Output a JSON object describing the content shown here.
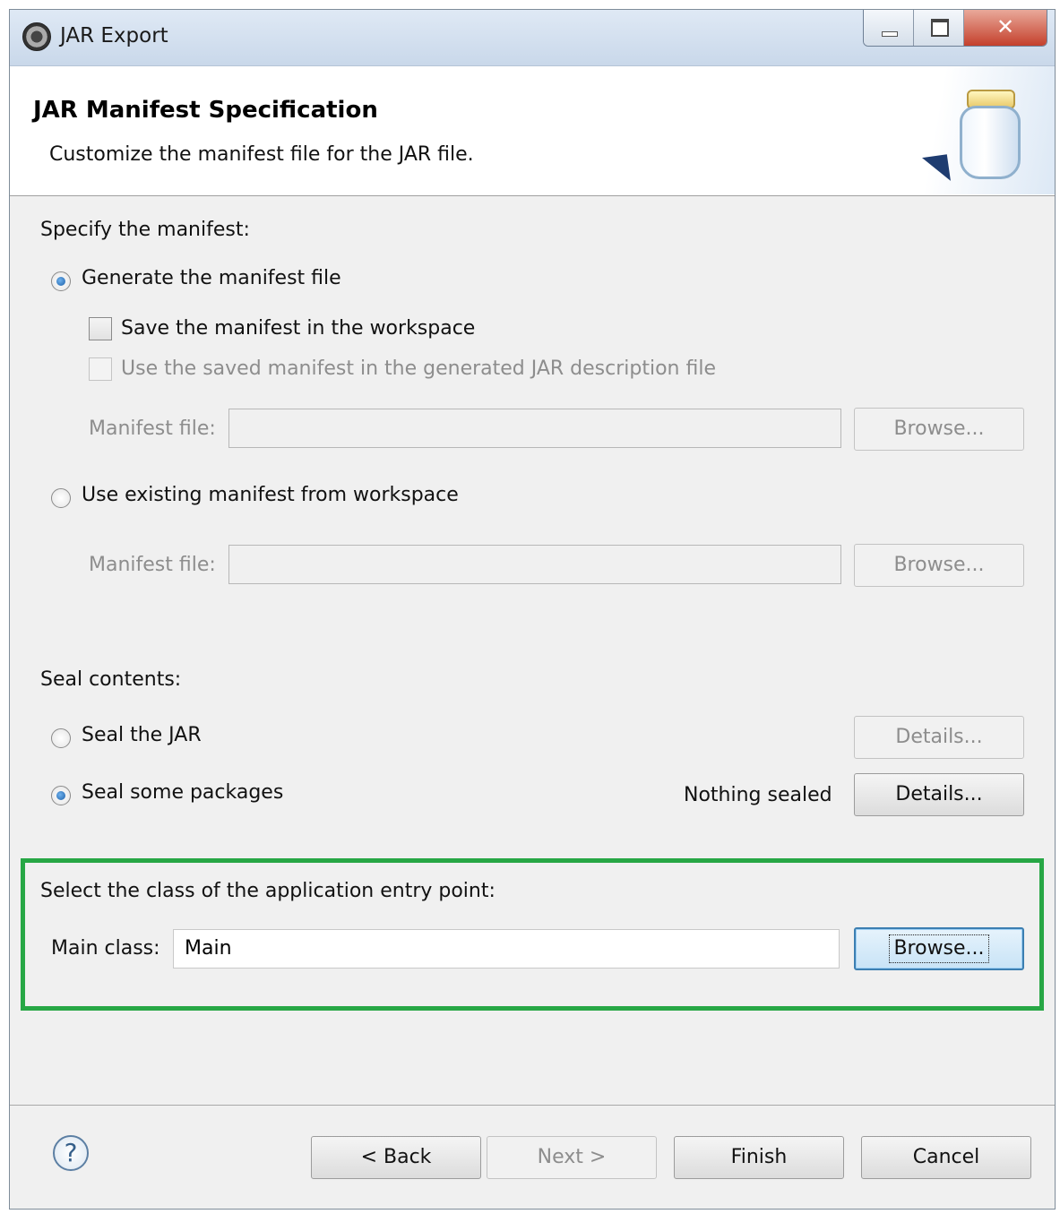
{
  "window": {
    "title": "JAR Export",
    "icon": "eclipse-icon"
  },
  "header": {
    "title": "JAR Manifest Specification",
    "description": "Customize the manifest file for the JAR file.",
    "graphic": "jar-icon"
  },
  "manifest": {
    "section_label": "Specify the manifest:",
    "generate_option": {
      "label": "Generate the manifest file",
      "selected": true
    },
    "save_checkbox": {
      "label": "Save the manifest in the workspace",
      "checked": false
    },
    "use_saved_checkbox": {
      "label": "Use the saved manifest in the generated JAR description file",
      "checked": false,
      "enabled": false
    },
    "generate_file": {
      "label": "Manifest file:",
      "value": "",
      "browse_label": "Browse..."
    },
    "existing_option": {
      "label": "Use existing manifest from workspace",
      "selected": false
    },
    "existing_file": {
      "label": "Manifest file:",
      "value": "",
      "browse_label": "Browse..."
    }
  },
  "seal": {
    "section_label": "Seal contents:",
    "seal_jar": {
      "label": "Seal the JAR",
      "selected": false,
      "details_label": "Details..."
    },
    "seal_some": {
      "label": "Seal some packages",
      "selected": true,
      "status": "Nothing sealed",
      "details_label": "Details..."
    }
  },
  "entry_point": {
    "section_label": "Select the class of the application entry point:",
    "main_class_label": "Main class:",
    "main_class_value": "Main",
    "browse_label": "Browse..."
  },
  "footer": {
    "back_label": "< Back",
    "next_label": "Next >",
    "finish_label": "Finish",
    "cancel_label": "Cancel",
    "help_icon": "help-icon"
  },
  "colors": {
    "highlight": "#27a745",
    "accent": "#3c7fb1"
  }
}
